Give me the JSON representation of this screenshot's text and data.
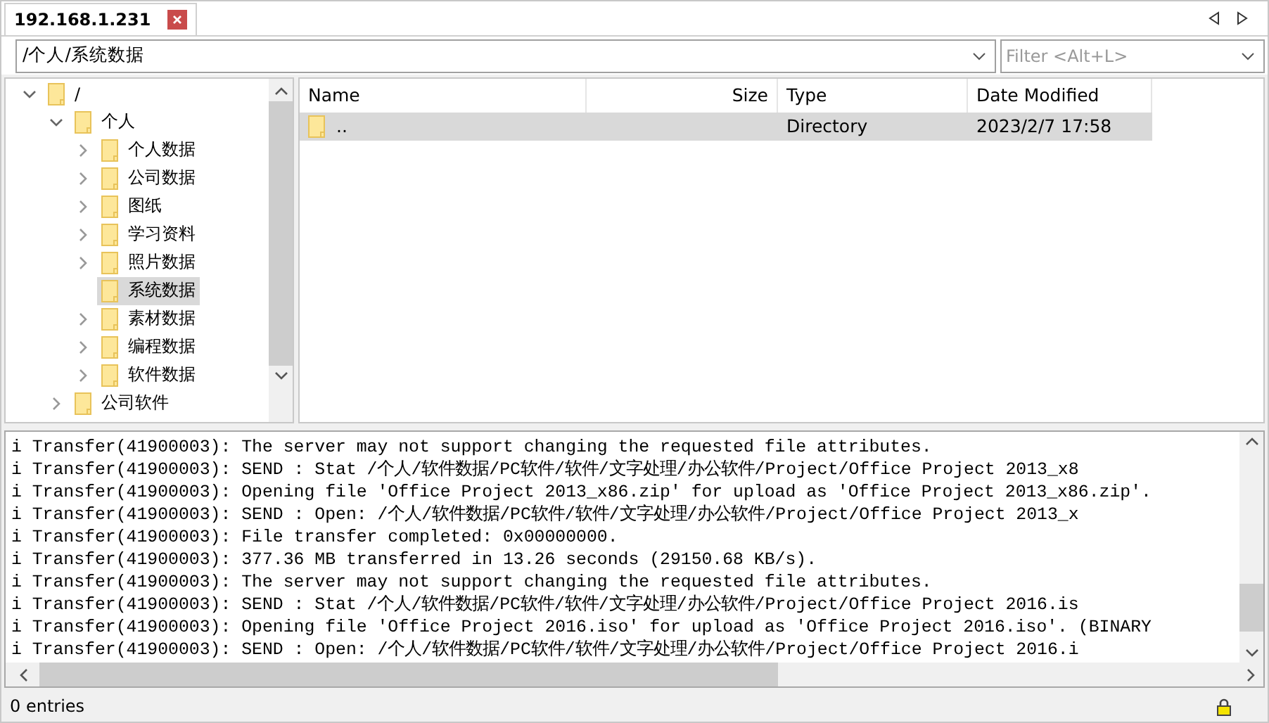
{
  "tabs": [
    {
      "label": "192.168.1.231",
      "selected": true
    }
  ],
  "path_field": {
    "value": "/个人/系统数据"
  },
  "filter_field": {
    "placeholder": "Filter <Alt+L>"
  },
  "tree": [
    {
      "label": "/",
      "expanded": true,
      "selected": false,
      "children": [
        {
          "label": "个人",
          "expanded": true,
          "selected": false,
          "children": [
            {
              "label": "个人数据",
              "expanded": false,
              "selected": false
            },
            {
              "label": "公司数据",
              "expanded": false,
              "selected": false
            },
            {
              "label": "图纸",
              "expanded": false,
              "selected": false
            },
            {
              "label": "学习资料",
              "expanded": false,
              "selected": false
            },
            {
              "label": "照片数据",
              "expanded": false,
              "selected": false
            },
            {
              "label": "系统数据",
              "selected": true
            },
            {
              "label": "素材数据",
              "expanded": false,
              "selected": false
            },
            {
              "label": "编程数据",
              "expanded": false,
              "selected": false
            },
            {
              "label": "软件数据",
              "expanded": false,
              "selected": false
            }
          ]
        },
        {
          "label": "公司软件",
          "expanded": false,
          "selected": false
        }
      ]
    }
  ],
  "table": {
    "columns": [
      "Name",
      "Size",
      "Type",
      "Date Modified"
    ],
    "rows": [
      {
        "name": "..",
        "type": "Directory",
        "date_modified": "2023/2/7 17:58",
        "selected": true
      }
    ]
  },
  "log": [
    {
      "level": "i",
      "text": "Transfer(41900003): The server may not support changing the requested file attributes."
    },
    {
      "level": "i",
      "text": "Transfer(41900003): SEND : Stat /个人/软件数据/PC软件/软件/文字处理/办公软件/Project/Office Project 2013_x8"
    },
    {
      "level": "i",
      "text": "Transfer(41900003): Opening file 'Office Project 2013_x86.zip' for upload as 'Office Project 2013_x86.zip'."
    },
    {
      "level": "i",
      "text": "Transfer(41900003): SEND : Open: /个人/软件数据/PC软件/软件/文字处理/办公软件/Project/Office Project 2013_x"
    },
    {
      "level": "i",
      "text": "Transfer(41900003): File transfer completed: 0x00000000."
    },
    {
      "level": "i",
      "text": "Transfer(41900003): 377.36 MB transferred in 13.26 seconds (29150.68 KB/s)."
    },
    {
      "level": "i",
      "text": "Transfer(41900003): The server may not support changing the requested file attributes."
    },
    {
      "level": "i",
      "text": "Transfer(41900003): SEND : Stat /个人/软件数据/PC软件/软件/文字处理/办公软件/Project/Office Project 2016.is"
    },
    {
      "level": "i",
      "text": "Transfer(41900003): Opening file 'Office Project 2016.iso' for upload as 'Office Project 2016.iso'. (BINARY"
    },
    {
      "level": "i",
      "text": "Transfer(41900003): SEND : Open: /个人/软件数据/PC软件/软件/文字处理/办公软件/Project/Office Project 2016.i"
    }
  ],
  "status_bar": {
    "text": "0 entries"
  }
}
